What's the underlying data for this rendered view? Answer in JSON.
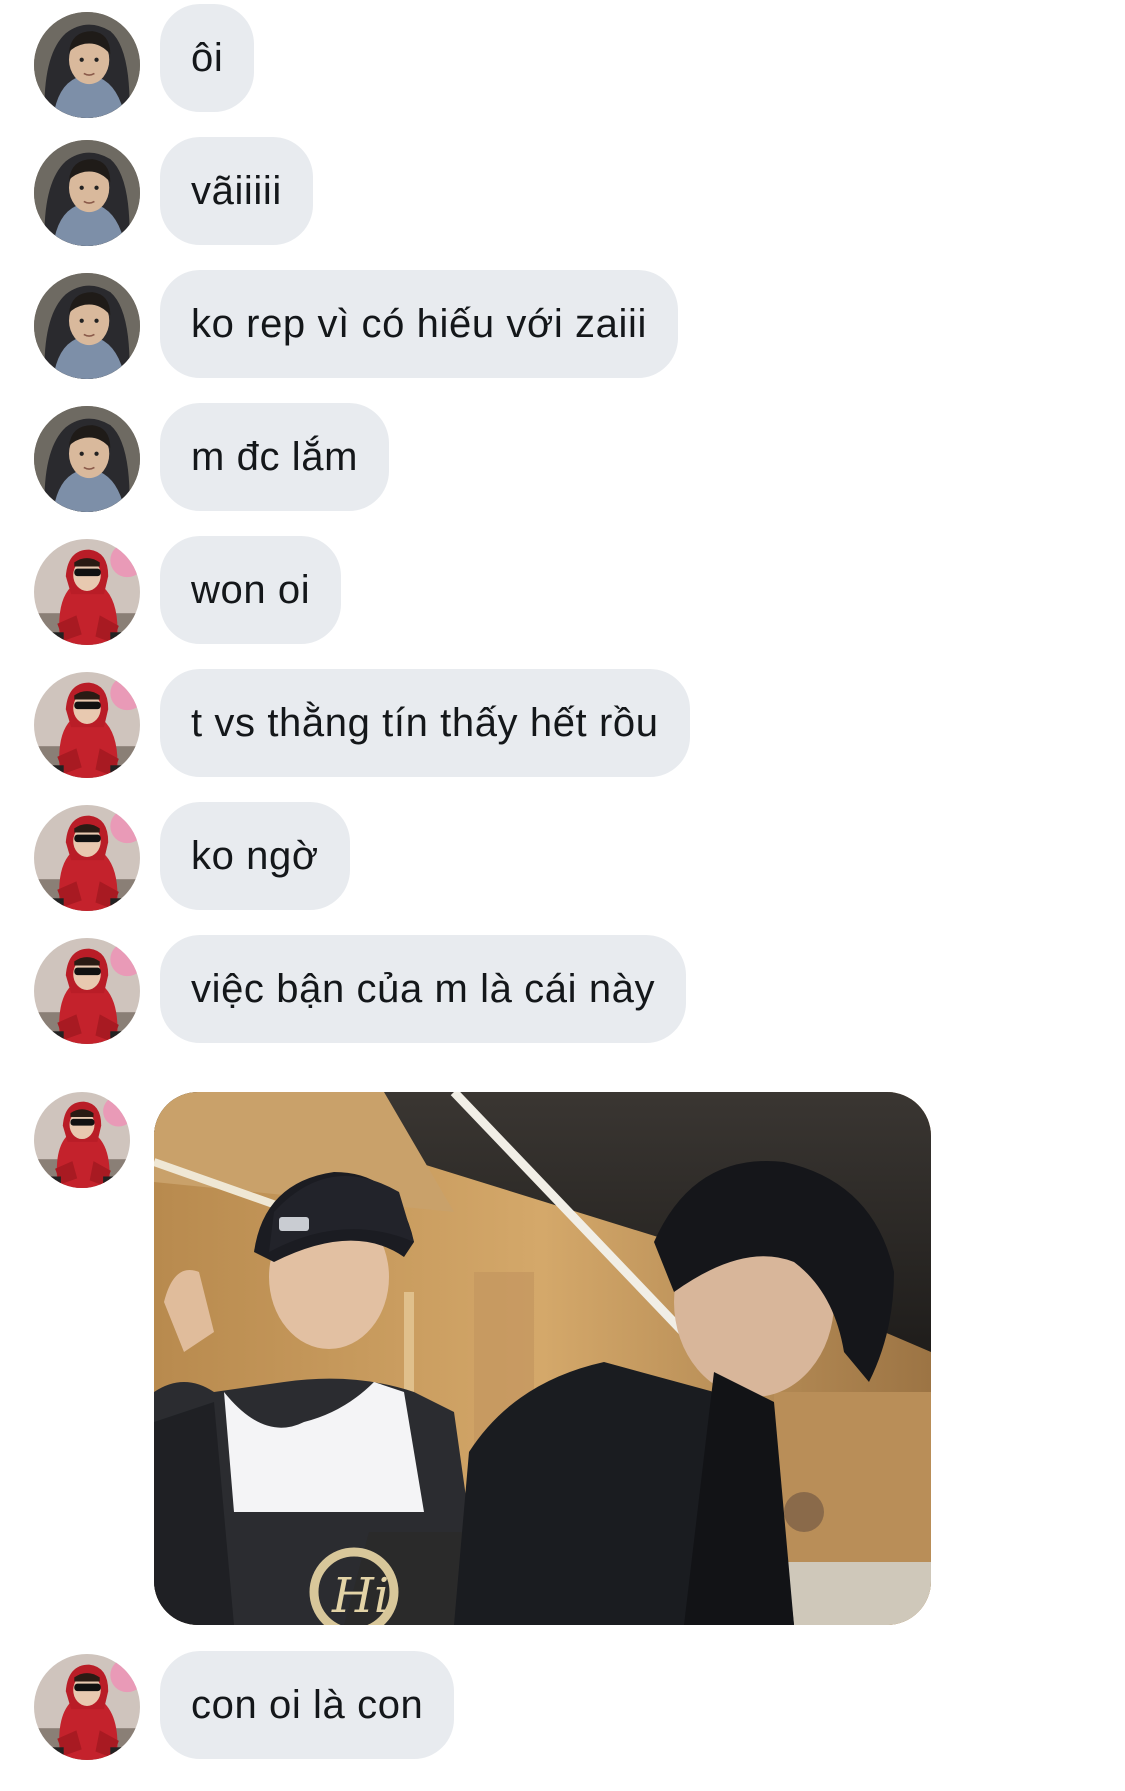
{
  "messages": [
    {
      "sender": "user-a",
      "text": "ôi"
    },
    {
      "sender": "user-a",
      "text": "vãiiiii"
    },
    {
      "sender": "user-a",
      "text": "ko rep vì có hiếu với zaiii"
    },
    {
      "sender": "user-a",
      "text": "m đc lắm"
    },
    {
      "sender": "user-b",
      "text": "won oi"
    },
    {
      "sender": "user-b",
      "text": "t vs thằng tín thấy hết rồu"
    },
    {
      "sender": "user-b",
      "text": "ko ngờ"
    },
    {
      "sender": "user-b",
      "text": "việc bận của m là cái này"
    },
    {
      "sender": "user-b",
      "type": "image",
      "image": "two-people-photo"
    },
    {
      "sender": "user-b",
      "text": "con oi là con"
    }
  ],
  "photo_print": "Hi",
  "colors": {
    "bubble": "#e8ebef",
    "text": "#14171a",
    "background": "#ffffff"
  }
}
